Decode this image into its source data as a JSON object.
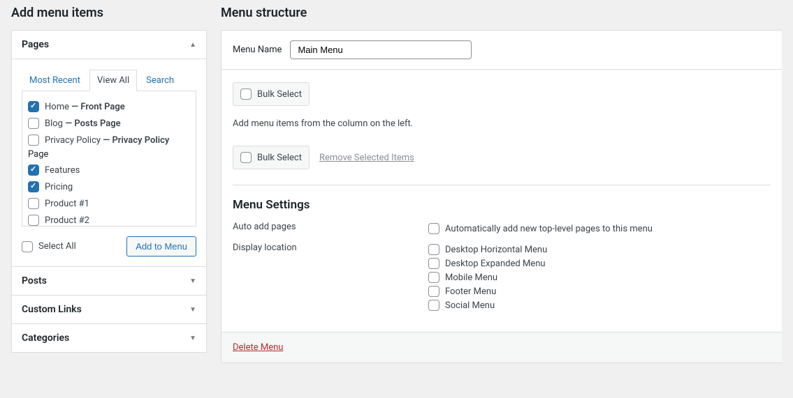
{
  "left": {
    "title": "Add menu items",
    "sections": {
      "pages": {
        "title": "Pages",
        "tabs": [
          "Most Recent",
          "View All",
          "Search"
        ],
        "activeTab": "View All",
        "selectAll": "Select All",
        "addButton": "Add to Menu",
        "subhead": "Page",
        "items": [
          {
            "label": "Home",
            "suffix": " — Front Page",
            "checked": true
          },
          {
            "label": "Blog",
            "suffix": " — Posts Page",
            "checked": false
          },
          {
            "label": "Privacy Policy",
            "suffix": " — Privacy Policy",
            "checked": false
          }
        ],
        "subitems": [
          {
            "label": "Features",
            "checked": true
          },
          {
            "label": "Pricing",
            "checked": true
          },
          {
            "label": "Product #1",
            "checked": false
          },
          {
            "label": "Product #2",
            "checked": false
          }
        ]
      },
      "posts": {
        "title": "Posts"
      },
      "customLinks": {
        "title": "Custom Links"
      },
      "categories": {
        "title": "Categories"
      }
    }
  },
  "right": {
    "title": "Menu structure",
    "menuNameLabel": "Menu Name",
    "menuNameValue": "Main Menu",
    "bulkSelect": "Bulk Select",
    "hint": "Add menu items from the column on the left.",
    "removeSelected": "Remove Selected Items",
    "settingsTitle": "Menu Settings",
    "autoAdd": {
      "label": "Auto add pages",
      "option": "Automatically add new top-level pages to this menu"
    },
    "displayLocation": {
      "label": "Display location",
      "options": [
        "Desktop Horizontal Menu",
        "Desktop Expanded Menu",
        "Mobile Menu",
        "Footer Menu",
        "Social Menu"
      ]
    },
    "deleteMenu": "Delete Menu"
  }
}
